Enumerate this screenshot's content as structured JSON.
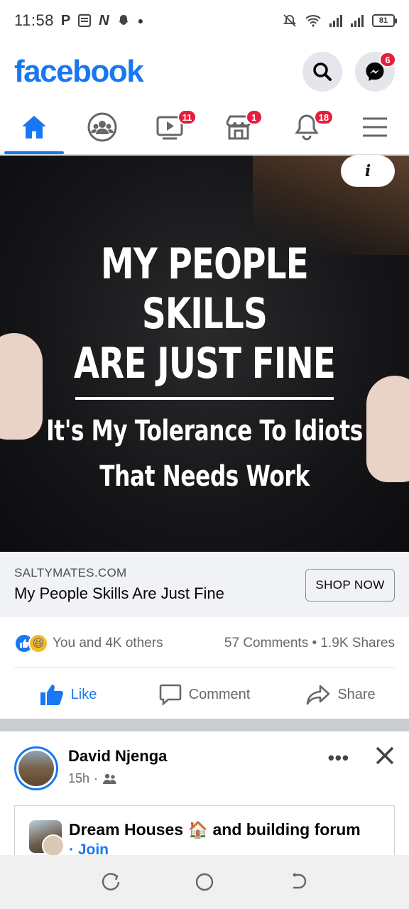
{
  "status_bar": {
    "time": "11:58",
    "left_icons": [
      "parking-icon",
      "news-icon",
      "n-app-icon",
      "snapchat-icon",
      "dot-icon"
    ],
    "battery": "81"
  },
  "header": {
    "logo": "facebook",
    "messenger_badge": "6"
  },
  "tabs": [
    {
      "name": "home",
      "badge": ""
    },
    {
      "name": "groups",
      "badge": ""
    },
    {
      "name": "watch",
      "badge": "11"
    },
    {
      "name": "marketplace",
      "badge": "1"
    },
    {
      "name": "notifications",
      "badge": "18"
    },
    {
      "name": "menu",
      "badge": ""
    }
  ],
  "ad": {
    "image_text": {
      "line1": "MY PEOPLE SKILLS",
      "line2": "ARE JUST FINE",
      "line3": "It's My Tolerance To Idiots",
      "line4": "That Needs Work"
    },
    "info_label": "i",
    "domain": "SALTYMATES.COM",
    "title": "My People Skills Are Just Fine",
    "cta": "SHOP NOW"
  },
  "engagement": {
    "reactions_text": "You and 4K others",
    "comments": "57 Comments",
    "separator": "•",
    "shares": "1.9K Shares"
  },
  "actions": {
    "like": "Like",
    "comment": "Comment",
    "share": "Share"
  },
  "next_post": {
    "author": "David Njenga",
    "time": "15h",
    "meta_separator": "·",
    "more": "•••",
    "group": {
      "name": "Dream  Houses 🏠 and building forum",
      "join_prefix": "·",
      "join": "Join"
    }
  },
  "colors": {
    "brand": "#1877f2",
    "badge": "#e41e3f"
  }
}
